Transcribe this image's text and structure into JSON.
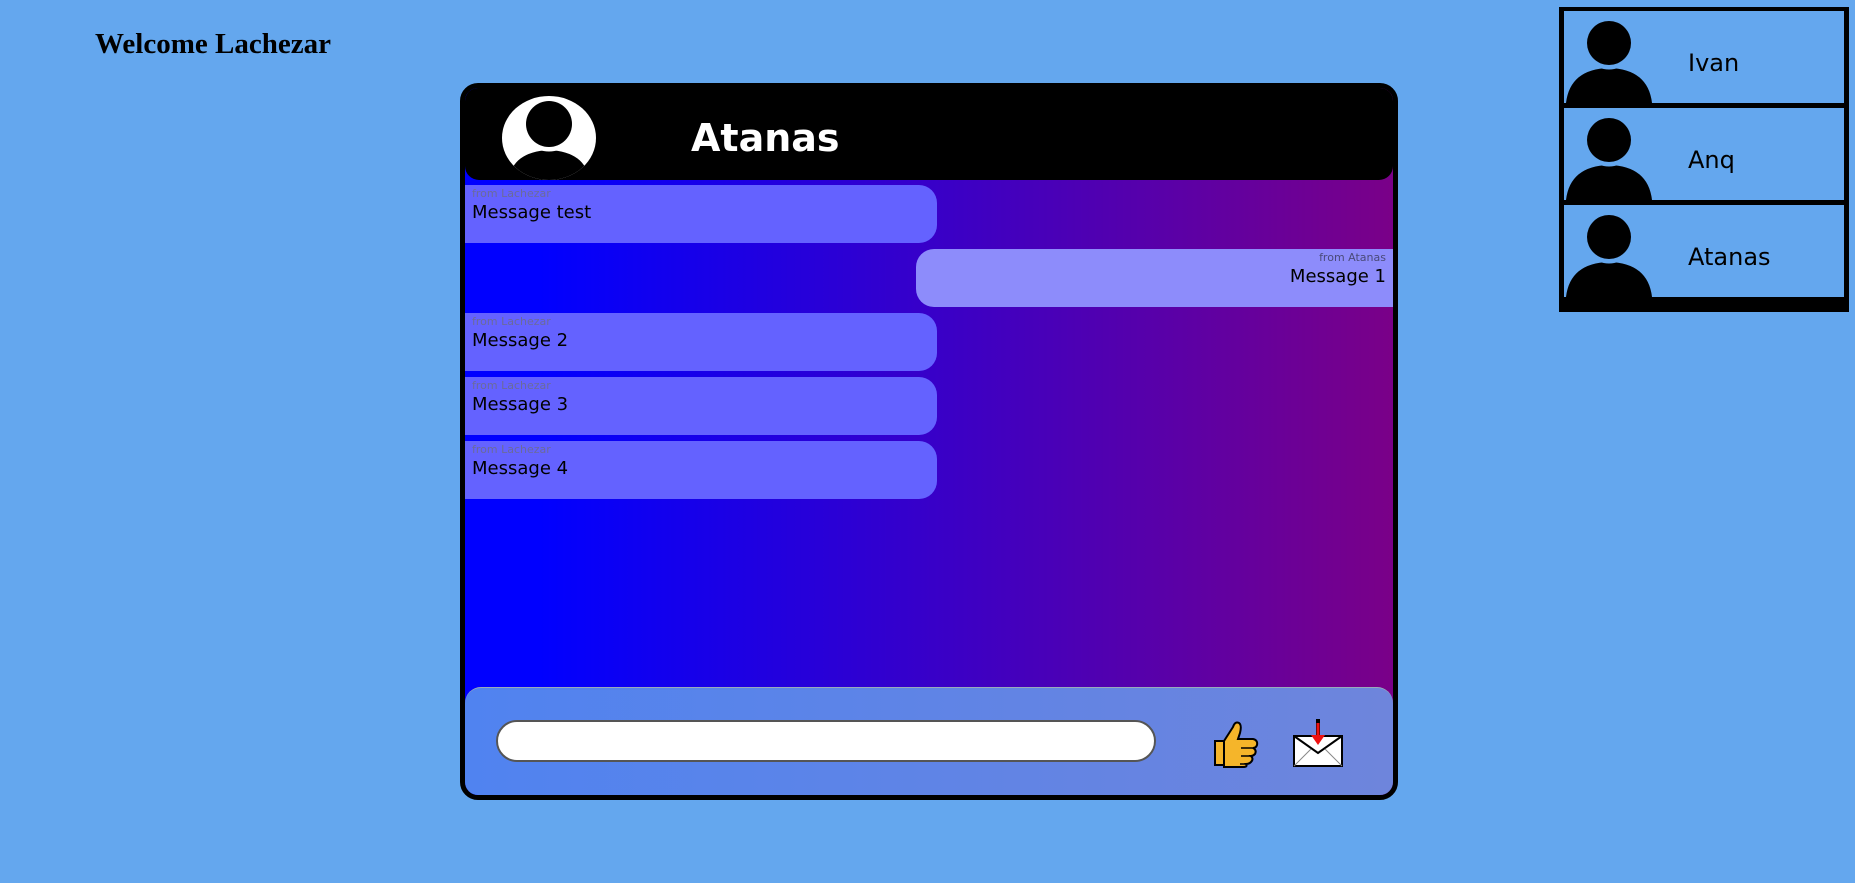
{
  "welcome_text": "Welcome Lachezar",
  "chat": {
    "contact_name": "Atanas",
    "avatar_icon": "user-avatar-icon",
    "messages": [
      {
        "direction": "out",
        "from": "from Lachezar",
        "text": "Message test"
      },
      {
        "direction": "in",
        "from": "from Atanas",
        "text": "Message 1"
      },
      {
        "direction": "out",
        "from": "from Lachezar",
        "text": "Message 2"
      },
      {
        "direction": "out",
        "from": "from Lachezar",
        "text": "Message 3"
      },
      {
        "direction": "out",
        "from": "from Lachezar",
        "text": "Message 4"
      }
    ],
    "input": {
      "value": "",
      "placeholder": ""
    },
    "like_icon": "thumbs-up-icon",
    "send_icon": "envelope-send-icon"
  },
  "contacts": [
    {
      "name": "Ivan"
    },
    {
      "name": "Anq"
    },
    {
      "name": "Atanas"
    }
  ],
  "colors": {
    "background": "#64a7ee",
    "header": "#000000",
    "outgoing_bubble": "#6462ff",
    "incoming_bubble": "#8d8cfb",
    "gradient_start": "#0000ff",
    "gradient_end": "#7a0088"
  }
}
